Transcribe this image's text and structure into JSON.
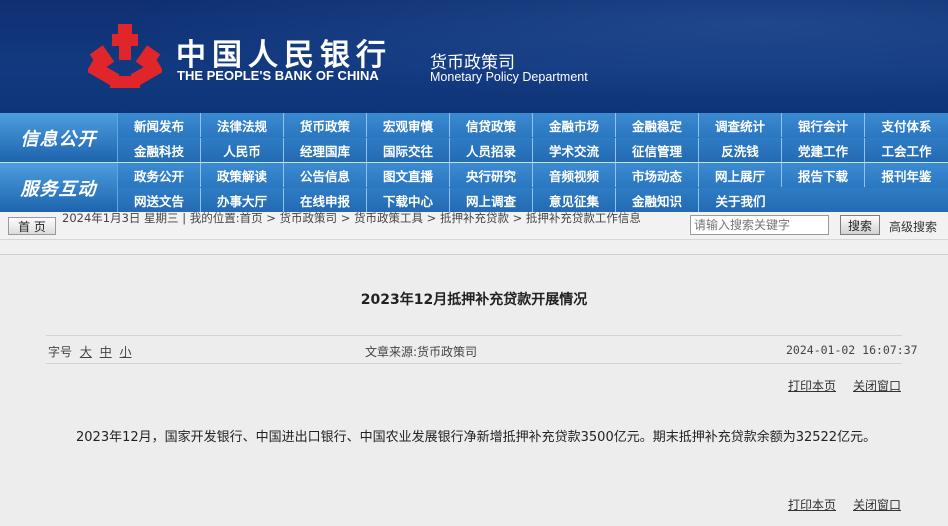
{
  "header": {
    "bank_cn": "中国人民银行",
    "bank_en": "THE PEOPLE'S BANK OF CHINA",
    "dept_cn": "货币政策司",
    "dept_en": "Monetary Policy Department",
    "logo_color": "#e0262a"
  },
  "nav": {
    "sections": [
      "信息公开",
      "服务互动"
    ],
    "rows": [
      [
        "新闻发布",
        "法律法规",
        "货币政策",
        "宏观审慎",
        "信贷政策",
        "金融市场",
        "金融稳定",
        "调查统计",
        "银行会计",
        "支付体系"
      ],
      [
        "金融科技",
        "人民币",
        "经理国库",
        "国际交往",
        "人员招录",
        "学术交流",
        "征信管理",
        "反洗钱",
        "党建工作",
        "工会工作"
      ],
      [
        "政务公开",
        "政策解读",
        "公告信息",
        "图文直播",
        "央行研究",
        "音频视频",
        "市场动态",
        "网上展厅",
        "报告下载",
        "报刊年鉴"
      ],
      [
        "网送文告",
        "办事大厅",
        "在线申报",
        "下载中心",
        "网上调查",
        "意见征集",
        "金融知识",
        "关于我们"
      ]
    ]
  },
  "crumbbar": {
    "home": "首 页",
    "text": "2024年1月3日 星期三 | 我的位置:首页 > 货币政策司 > 货币政策工具 > 抵押补充贷款 > 抵押补充贷款工作信息",
    "search_placeholder": "请输入搜索关键字",
    "search_button": "搜索",
    "advanced": "高级搜索"
  },
  "article": {
    "title": "2023年12月抵押补充贷款开展情况",
    "size_label": "字号",
    "sizes": [
      "大",
      "中",
      "小"
    ],
    "source": "文章来源:货币政策司",
    "date": "2024-01-02 16:07:37",
    "print": "打印本页",
    "close": "关闭窗口",
    "body": "2023年12月，国家开发银行、中国进出口银行、中国农业发展银行净新增抵押补充贷款3500亿元。期末抵押补充贷款余额为32522亿元。"
  }
}
